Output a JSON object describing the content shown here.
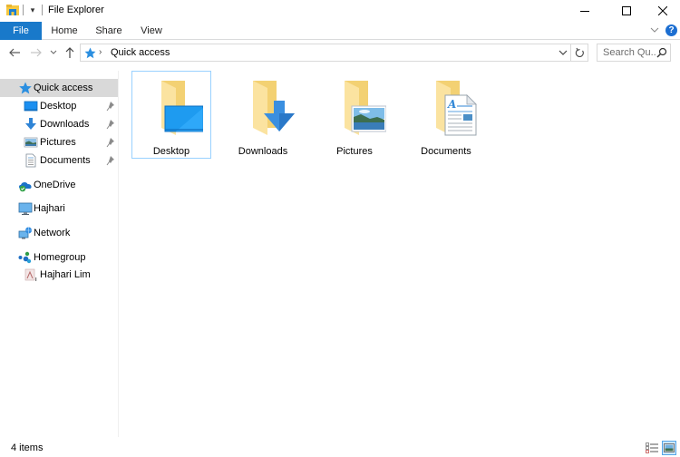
{
  "window": {
    "title": "File Explorer",
    "controls": {
      "minimize": "minimize",
      "maximize": "maximize",
      "close": "close"
    }
  },
  "quick_access_toolbar": {
    "dropdown_glyph": "▾"
  },
  "ribbon": {
    "tabs": [
      {
        "label": "File",
        "active": true
      },
      {
        "label": "Home"
      },
      {
        "label": "Share"
      },
      {
        "label": "View"
      }
    ],
    "help_glyph": "?"
  },
  "navigation": {
    "address_separator": "›",
    "address_path": "Quick access",
    "search_placeholder": "Search Qu..."
  },
  "nav_pane": {
    "items": [
      {
        "label": "Quick access",
        "icon": "star-icon",
        "selected": true
      },
      {
        "label": "Desktop",
        "icon": "desktop-icon",
        "pinned": true
      },
      {
        "label": "Downloads",
        "icon": "download-icon",
        "pinned": true
      },
      {
        "label": "Pictures",
        "icon": "pictures-icon",
        "pinned": true
      },
      {
        "label": "Documents",
        "icon": "documents-icon",
        "pinned": true
      },
      {
        "label": "OneDrive",
        "icon": "onedrive-icon"
      },
      {
        "label": "Hajhari",
        "icon": "computer-icon"
      },
      {
        "label": "Network",
        "icon": "network-icon"
      },
      {
        "label": "Homegroup",
        "icon": "homegroup-icon"
      },
      {
        "label": "Hajhari Lim",
        "icon": "user-icon"
      }
    ]
  },
  "content": {
    "folders": [
      {
        "label": "Desktop",
        "overlay": "desktop",
        "focused": true
      },
      {
        "label": "Downloads",
        "overlay": "download"
      },
      {
        "label": "Pictures",
        "overlay": "picture"
      },
      {
        "label": "Documents",
        "overlay": "document"
      }
    ]
  },
  "status_bar": {
    "item_count": "4 items",
    "views": [
      {
        "name": "details-view"
      },
      {
        "name": "large-icons-view",
        "active": true
      }
    ]
  },
  "colors": {
    "accent": "#1979ca",
    "selection": "#d9d9d9",
    "focus_border": "#99d1ff",
    "folder": "#f8d775"
  }
}
